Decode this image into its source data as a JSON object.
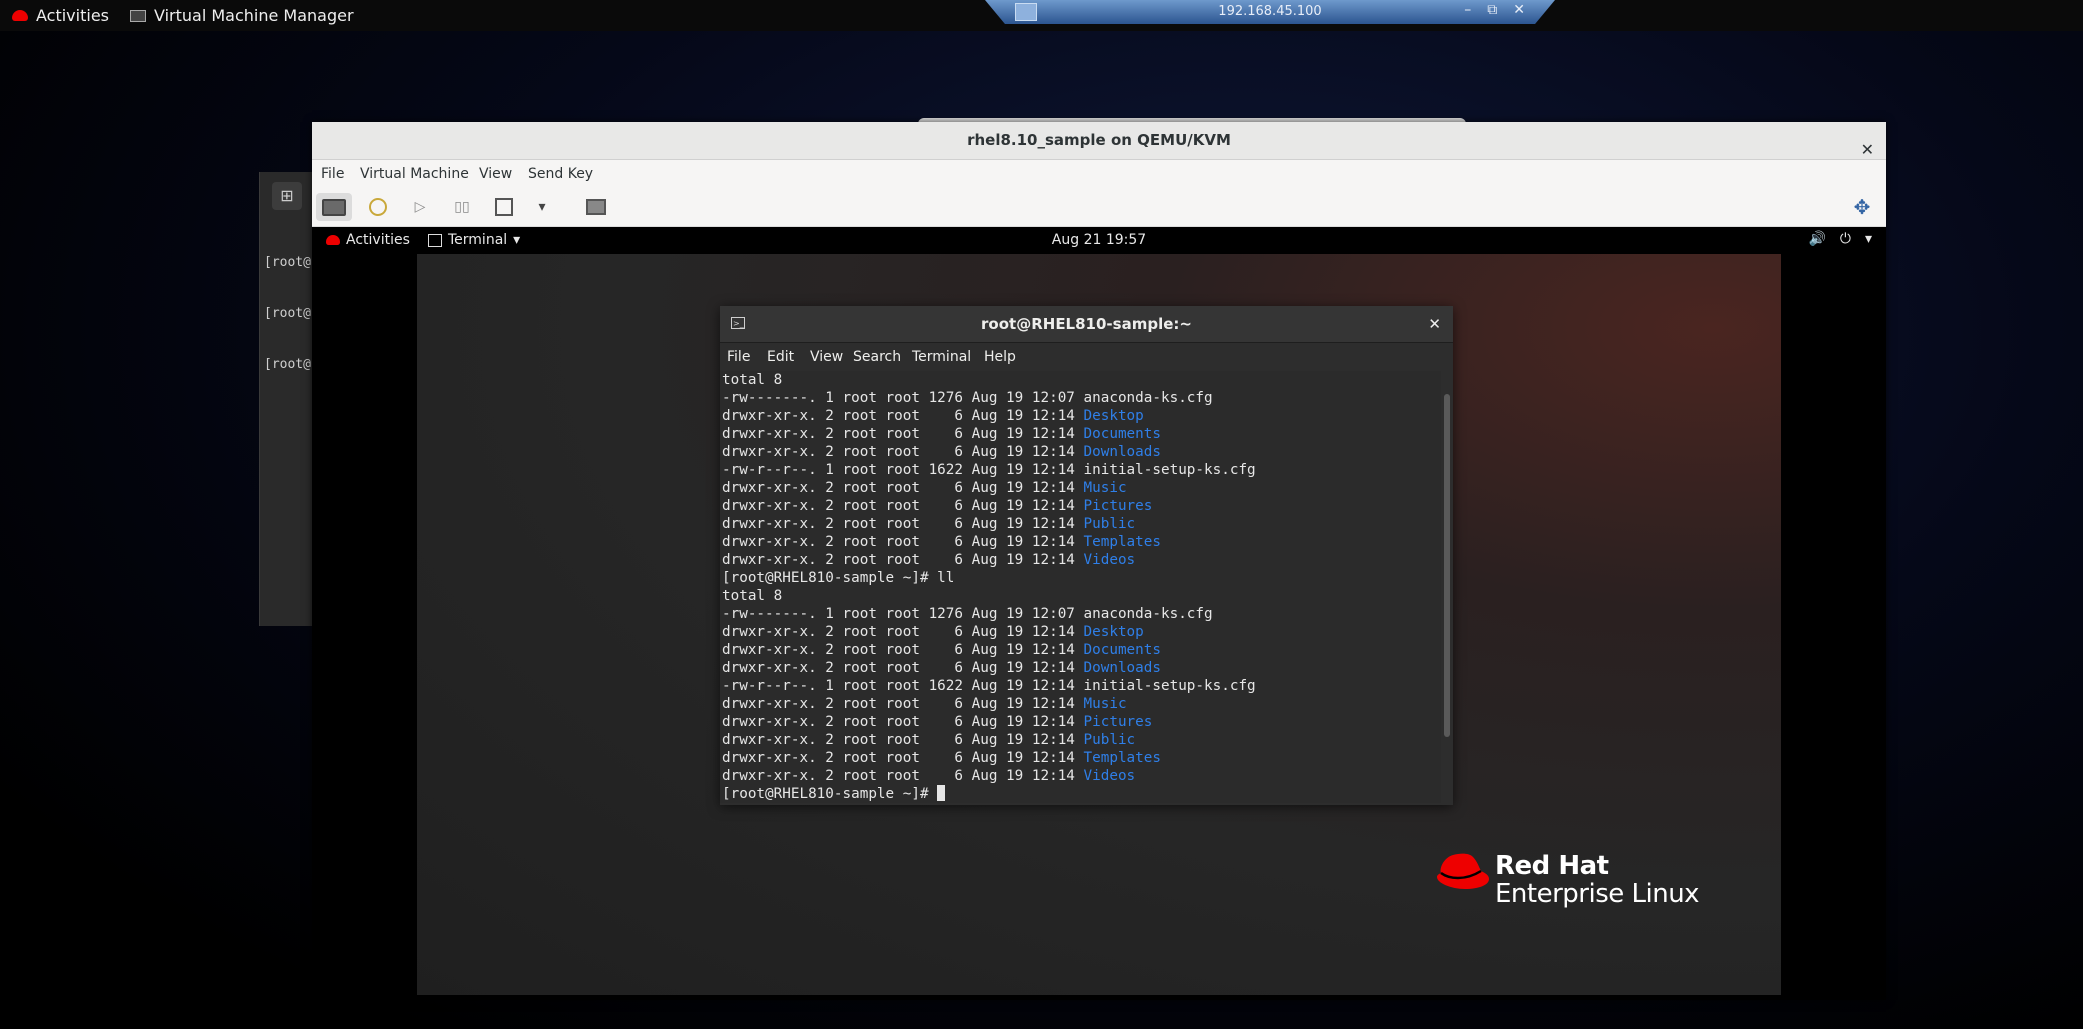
{
  "host_topbar": {
    "activities": "Activities",
    "app_name": "Virtual Machine Manager"
  },
  "remote_bar": {
    "title": "192.168.45.100",
    "minimize": "–",
    "restore": "⧉",
    "close": "✕"
  },
  "background_window": {
    "lines": [
      "[root@",
      "[root@",
      "[root@"
    ]
  },
  "vm_window": {
    "title": "rhel8.10_sample on QEMU/KVM",
    "close": "✕",
    "menu": [
      "File",
      "Virtual Machine",
      "View",
      "Send Key"
    ]
  },
  "guest": {
    "topbar": {
      "activities": "Activities",
      "app_menu": "Terminal",
      "clock": "Aug 21  19:57"
    },
    "logo": {
      "line1": "Red Hat",
      "line2": "Enterprise Linux"
    },
    "terminal": {
      "title": "root@RHEL810-sample:~",
      "close": "✕",
      "menu": [
        "File",
        "Edit",
        "View",
        "Search",
        "Terminal",
        "Help"
      ],
      "listing_header": "total 8",
      "entries": [
        {
          "meta": "-rw-------. 1 root root 1276 Aug 19 12:07 ",
          "name": "anaconda-ks.cfg",
          "dir": false
        },
        {
          "meta": "drwxr-xr-x. 2 root root    6 Aug 19 12:14 ",
          "name": "Desktop",
          "dir": true
        },
        {
          "meta": "drwxr-xr-x. 2 root root    6 Aug 19 12:14 ",
          "name": "Documents",
          "dir": true
        },
        {
          "meta": "drwxr-xr-x. 2 root root    6 Aug 19 12:14 ",
          "name": "Downloads",
          "dir": true
        },
        {
          "meta": "-rw-r--r--. 1 root root 1622 Aug 19 12:14 ",
          "name": "initial-setup-ks.cfg",
          "dir": false
        },
        {
          "meta": "drwxr-xr-x. 2 root root    6 Aug 19 12:14 ",
          "name": "Music",
          "dir": true
        },
        {
          "meta": "drwxr-xr-x. 2 root root    6 Aug 19 12:14 ",
          "name": "Pictures",
          "dir": true
        },
        {
          "meta": "drwxr-xr-x. 2 root root    6 Aug 19 12:14 ",
          "name": "Public",
          "dir": true
        },
        {
          "meta": "drwxr-xr-x. 2 root root    6 Aug 19 12:14 ",
          "name": "Templates",
          "dir": true
        },
        {
          "meta": "drwxr-xr-x. 2 root root    6 Aug 19 12:14 ",
          "name": "Videos",
          "dir": true
        }
      ],
      "command_line": "[root@RHEL810-sample ~]# ll",
      "prompt": "[root@RHEL810-sample ~]# "
    }
  },
  "colors": {
    "dir_blue": "#2f7fe8",
    "redhat_red": "#ee0000"
  }
}
